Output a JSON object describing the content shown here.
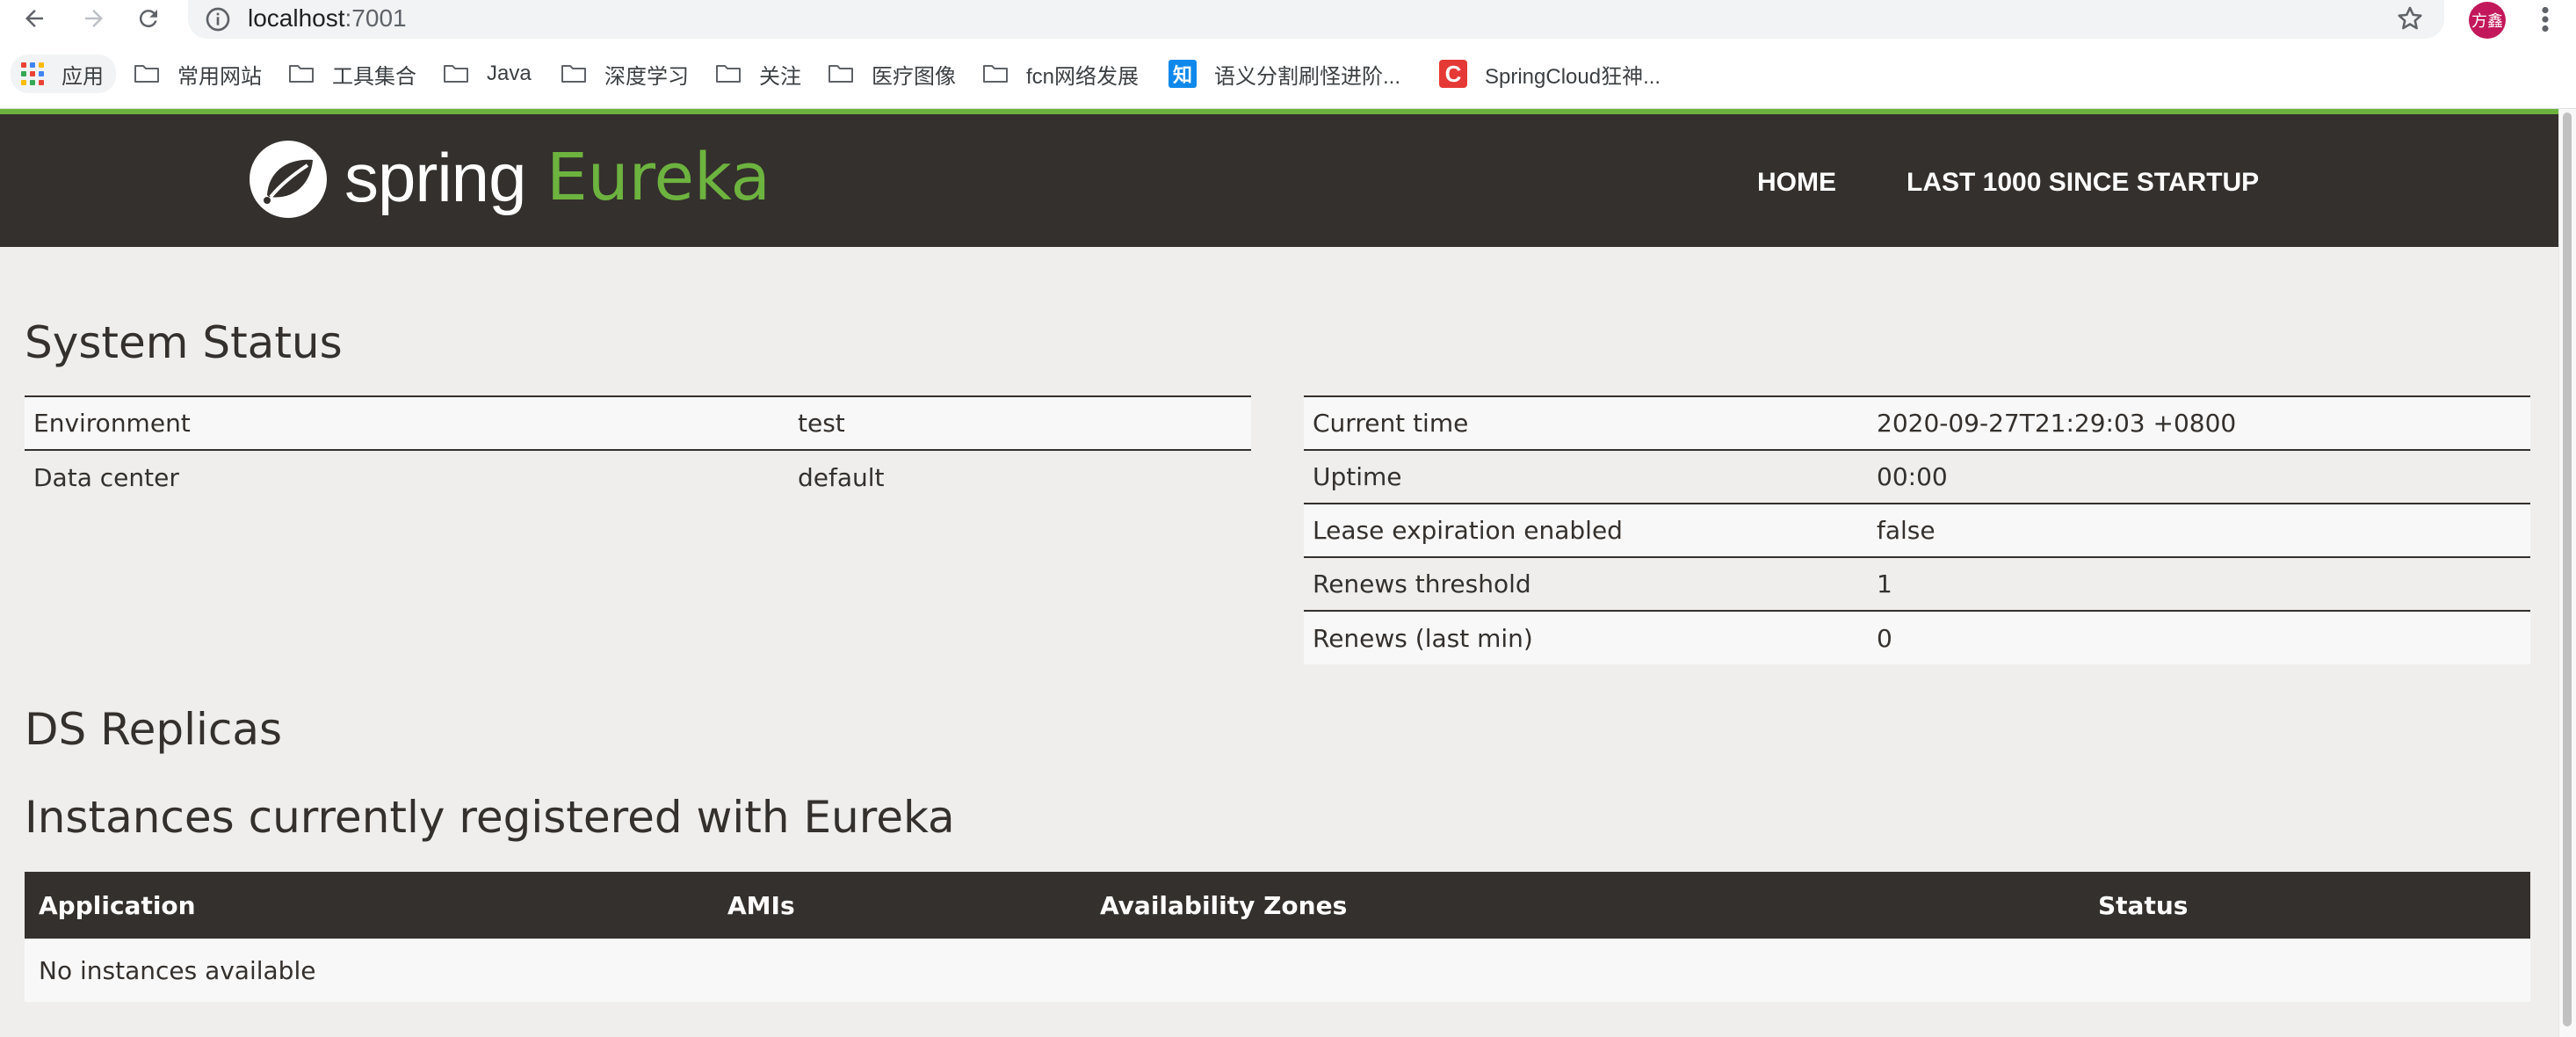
{
  "browser": {
    "url_host": "localhost",
    "url_port": ":7001",
    "profile_avatar_text": "方鑫",
    "bookmarks": [
      {
        "label": "应用",
        "icon": "apps-grid-icon"
      },
      {
        "label": "常用网站",
        "icon": "folder-icon"
      },
      {
        "label": "工具集合",
        "icon": "folder-icon"
      },
      {
        "label": "Java",
        "icon": "folder-icon"
      },
      {
        "label": "深度学习",
        "icon": "folder-icon"
      },
      {
        "label": "关注",
        "icon": "folder-icon"
      },
      {
        "label": "医疗图像",
        "icon": "folder-icon"
      },
      {
        "label": "fcn网络发展",
        "icon": "folder-icon"
      },
      {
        "label": "语义分割刷怪进阶...",
        "icon": "zhihu-icon",
        "icon_text": "知"
      },
      {
        "label": "SpringCloud狂神...",
        "icon": "csdn-icon",
        "icon_text": "C"
      }
    ]
  },
  "header": {
    "logo_spring": "spring",
    "logo_eureka": "Eureka",
    "nav": {
      "home": "HOME",
      "last1000": "LAST 1000 SINCE STARTUP"
    }
  },
  "system_status": {
    "title": "System Status",
    "left": [
      {
        "label": "Environment",
        "value": "test"
      },
      {
        "label": "Data center",
        "value": "default"
      }
    ],
    "right": [
      {
        "label": "Current time",
        "value": "2020-09-27T21:29:03 +0800"
      },
      {
        "label": "Uptime",
        "value": "00:00"
      },
      {
        "label": "Lease expiration enabled",
        "value": "false"
      },
      {
        "label": "Renews threshold",
        "value": "1"
      },
      {
        "label": "Renews (last min)",
        "value": "0"
      }
    ]
  },
  "ds_replicas": {
    "title": "DS Replicas"
  },
  "instances": {
    "title": "Instances currently registered with Eureka",
    "columns": [
      "Application",
      "AMIs",
      "Availability Zones",
      "Status"
    ],
    "empty_message": "No instances available"
  },
  "colors": {
    "header_bg": "#34302d",
    "accent_green": "#6db33f",
    "page_bg": "#efeeec",
    "row_light": "#f8f8f8"
  }
}
